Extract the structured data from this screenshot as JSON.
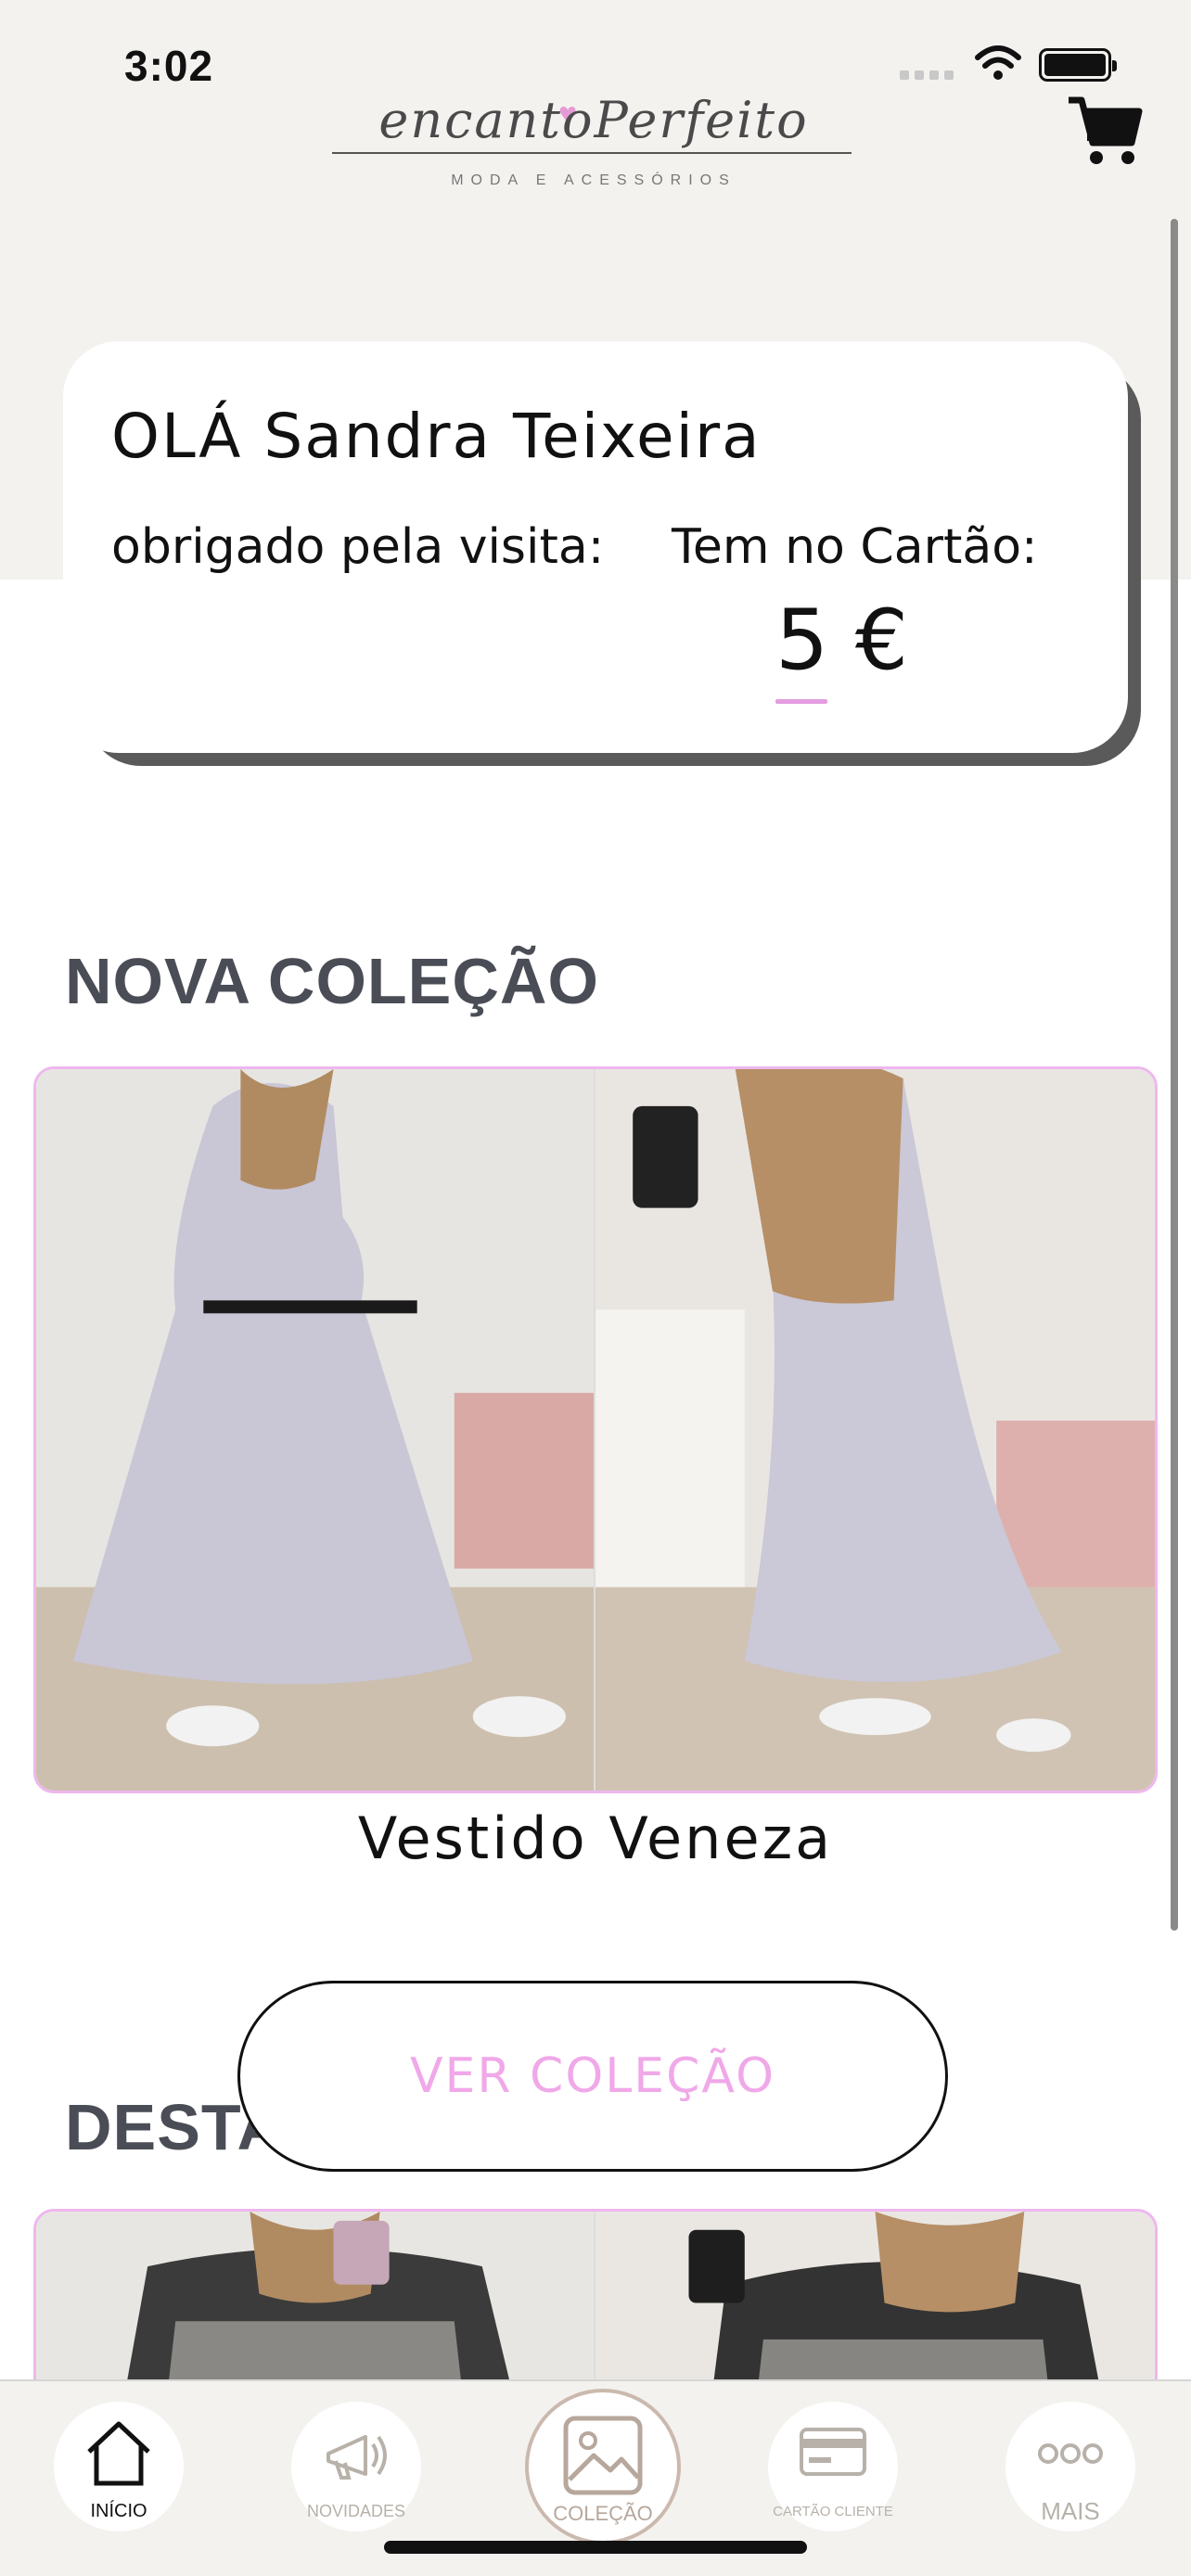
{
  "status_bar": {
    "time": "3:02"
  },
  "brand": {
    "logo_text": "encantoPerfeito",
    "logo_subtitle": "MODA E ACESSÓRIOS"
  },
  "welcome_card": {
    "greeting": "OLÁ Sandra Teixeira",
    "thanks": "obrigado pela visita:",
    "card_label": "Tem no Cartão:",
    "balance": "5 €"
  },
  "sections": {
    "new_collection_title": "NOVA COLEÇÃO",
    "featured_title": "DESTA"
  },
  "product": {
    "name": "Vestido Veneza"
  },
  "cta": {
    "label": "VER COLEÇÃO"
  },
  "tabbar": {
    "items": [
      {
        "label": "INÍCIO",
        "icon": "home-icon",
        "active": true
      },
      {
        "label": "NOVIDADES",
        "icon": "megaphone-icon",
        "active": false
      },
      {
        "label": "COLEÇÃO",
        "icon": "image-icon",
        "active": false
      },
      {
        "label": "CARTÃO CLIENTE",
        "icon": "card-icon",
        "active": false
      },
      {
        "label": "MAIS",
        "icon": "more-icon",
        "active": false
      }
    ]
  },
  "colors": {
    "accent_pink": "#f0a8e8",
    "header_bg": "#f3f2ef",
    "title_gray": "#4a4d55"
  }
}
